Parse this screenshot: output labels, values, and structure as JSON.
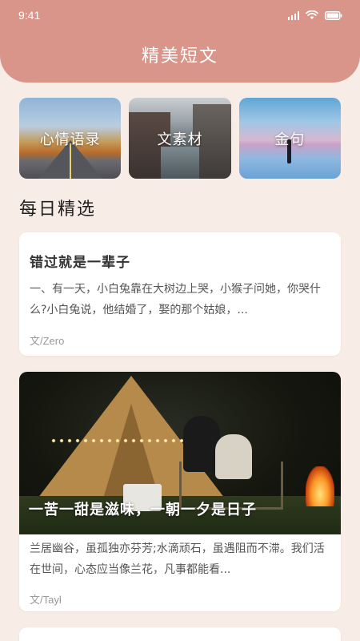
{
  "status_bar": {
    "time": "9:41"
  },
  "header": {
    "title": "精美短文"
  },
  "categories": [
    {
      "label": "心情语录"
    },
    {
      "label": "文素材"
    },
    {
      "label": "金句"
    }
  ],
  "section": {
    "title": "每日精选"
  },
  "articles": [
    {
      "title": "错过就是一辈子",
      "excerpt": "一、有一天，小白兔靠在大树边上哭，小猴子问她，你哭什么?小白兔说，他结婚了，娶的那个姑娘，...",
      "author": "文/Zero"
    },
    {
      "image_caption": "一苦一甜是滋味，一朝一夕是日子",
      "excerpt": "兰居幽谷，虽孤独亦芬芳;水滴顽石，虽遇阻而不滞。我们活在世间，心态应当像兰花，凡事都能看...",
      "author": "文/Tayl"
    }
  ],
  "colors": {
    "header": "#d9958a",
    "background": "#f7ece6",
    "card": "#ffffff"
  }
}
